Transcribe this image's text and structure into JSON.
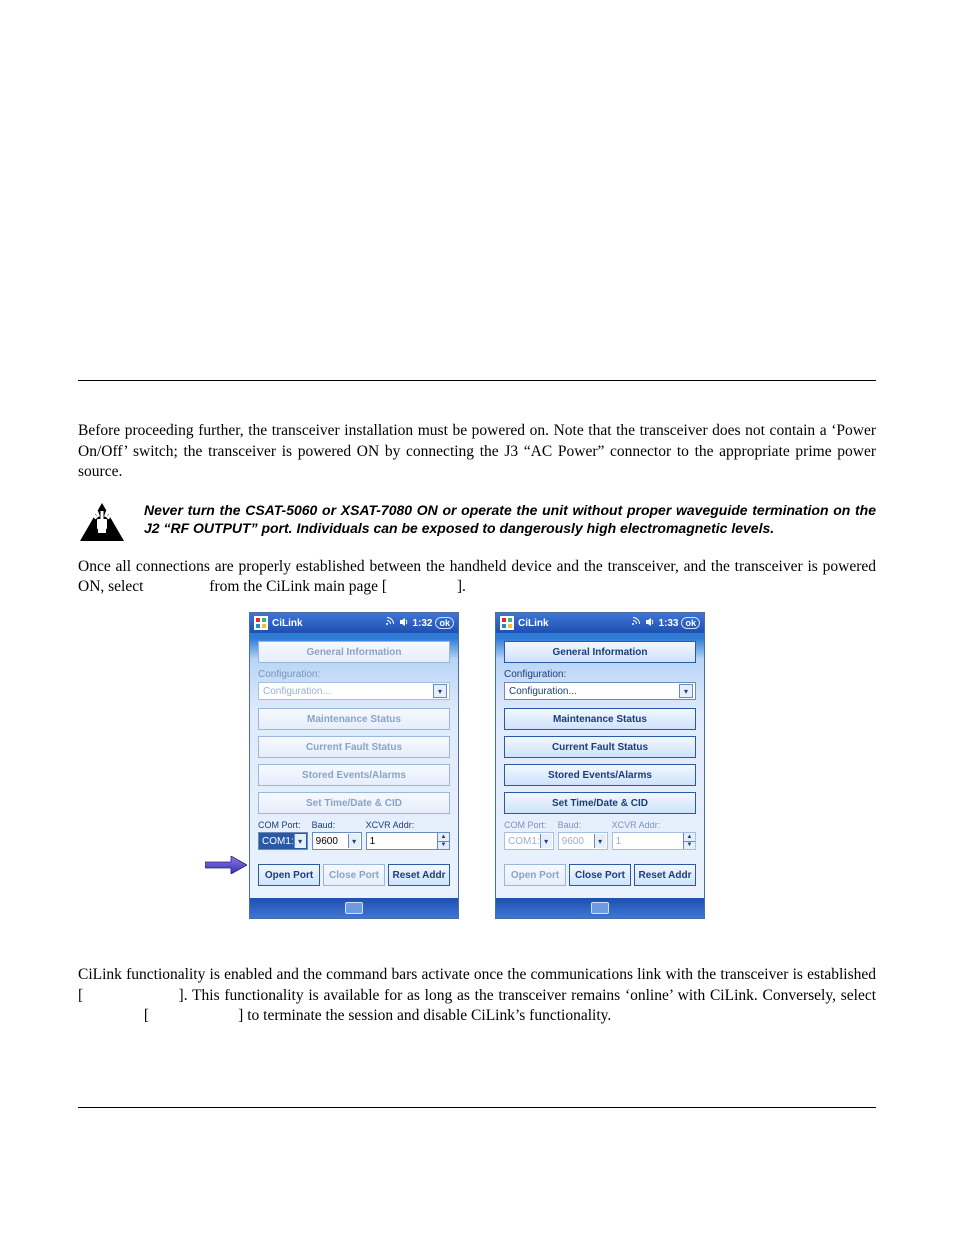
{
  "paragraphs": {
    "p1": "Before proceeding further, the transceiver installation must be powered on. Note that the transceiver does not contain a ‘Power On/Off’ switch; the transceiver is powered ON by connecting the J3 “AC Power” connector to the appropriate prime power source.",
    "warning": "Never turn the CSAT-5060 or XSAT-7080 ON or operate the unit without proper waveguide termination on the J2 “RF OUTPUT” port. Individuals can be exposed to dangerously high electromagnetic levels.",
    "p2a": "Once all connections are properly established between the handheld device and the transceiver, and the transceiver is powered ON, select ",
    "p2b": " from the CiLink main page [",
    "p2c": "].",
    "p3a": "CiLink functionality is enabled and the command bars activate once the communications link with the transceiver is established  [",
    "p3b": "]. This functionality is available for as long as the transceiver remains ‘online’ with CiLink. Conversely, select ",
    "p3c": " [",
    "p3d": "] to terminate the session and disable CiLink’s functionality."
  },
  "shot": {
    "app_title": "CiLink",
    "ok": "ok",
    "time_left": "1:32",
    "time_right": "1:33",
    "general_info": "General Information",
    "configuration_label": "Configuration:",
    "configuration_value": "Configuration...",
    "maintenance": "Maintenance Status",
    "current_fault": "Current Fault Status",
    "stored_events": "Stored Events/Alarms",
    "set_time": "Set Time/Date & CID",
    "com_port_label": "COM Port:",
    "baud_label": "Baud:",
    "xcvr_label": "XCVR Addr:",
    "com_port_value": "COM1:",
    "baud_value": "9600",
    "xcvr_value": "1",
    "open_port": "Open Port",
    "close_port": "Close Port",
    "reset_addr": "Reset Addr"
  }
}
